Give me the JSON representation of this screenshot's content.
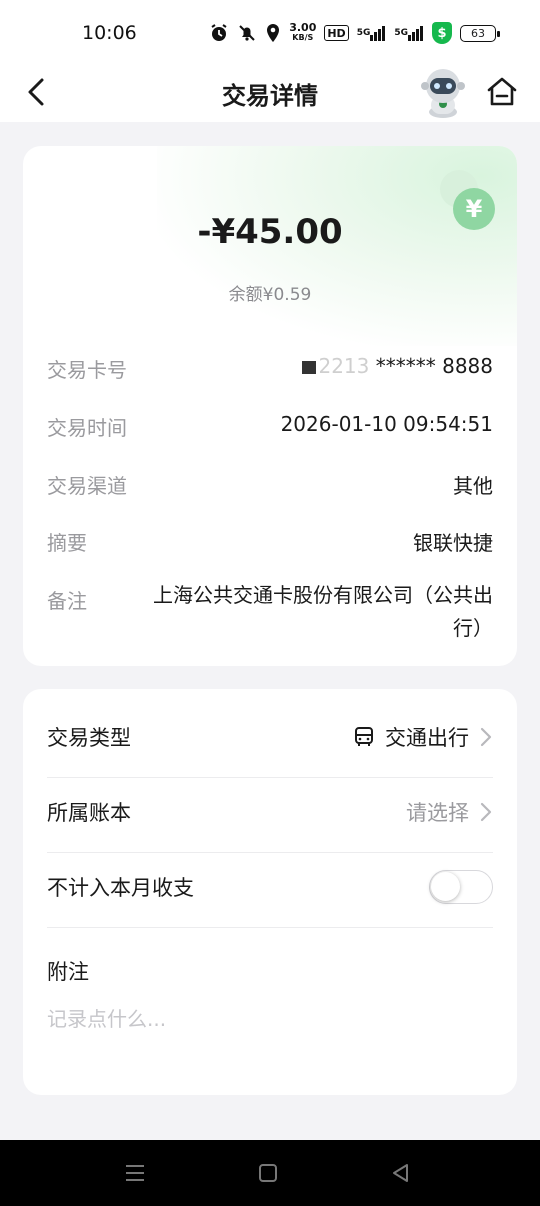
{
  "status_bar": {
    "time": "10:06",
    "speed_value": "3.00",
    "speed_unit": "KB/S",
    "hd_badge": "HD",
    "signal1_label": "5G",
    "signal2_label": "5G",
    "shield_symbol": "$",
    "battery": "63",
    "icons": [
      "alarm-icon",
      "bell-off-icon",
      "location-icon",
      "signal-icon",
      "shield-icon",
      "battery-icon"
    ]
  },
  "nav": {
    "title": "交易详情",
    "back_icon": "chevron-left-icon",
    "assistant_icon": "robot-avatar-icon",
    "home_icon": "home-icon"
  },
  "summary": {
    "amount": "-¥45.00",
    "balance": "余额¥0.59",
    "coin_symbol": "¥",
    "rows": {
      "card_label": "交易卡号",
      "card_visible_suffix": "****** 8888",
      "card_partial": "2213",
      "time_label": "交易时间",
      "time_value": "2026-01-10 09:54:51",
      "channel_label": "交易渠道",
      "channel_value": "其他",
      "summary_label": "摘要",
      "summary_value": "银联快捷",
      "remark_label": "备注",
      "remark_value": "上海公共交通卡股份有限公司（公共出行）"
    }
  },
  "details": {
    "type_label": "交易类型",
    "type_value": "交通出行",
    "type_icon": "bus-icon",
    "ledger_label": "所属账本",
    "ledger_value": "请选择",
    "exclude_label": "不计入本月收支",
    "exclude_enabled": false,
    "note_label": "附注",
    "note_placeholder": "记录点什么..."
  },
  "colors": {
    "accent_green": "#8fd6a2",
    "text_primary": "#1a1a1a",
    "text_secondary": "#9a9a9e",
    "background": "#f3f3f6"
  }
}
